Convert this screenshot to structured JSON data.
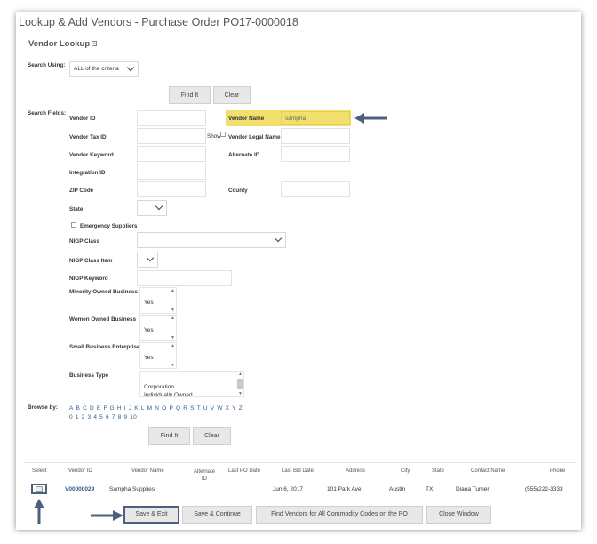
{
  "window": {
    "title": "Lookup & Add Vendors - Purchase Order PO17-0000018"
  },
  "section": {
    "title": "Vendor Lookup"
  },
  "search": {
    "search_using_label": "Search Using:",
    "search_using_value": "ALL of the criteria",
    "find_label": "Find It",
    "clear_label": "Clear",
    "fields_label": "Search Fields:"
  },
  "fields": {
    "vendor_id": "Vendor ID",
    "vendor_name": "Vendor Name",
    "vendor_name_value": "sampha",
    "vendor_tax_id": "Vendor Tax ID",
    "show": "Show",
    "vendor_legal_name": "Vendor Legal Name",
    "vendor_keyword": "Vendor Keyword",
    "alternate_id": "Alternate ID",
    "integration_id": "Integration ID",
    "zip_code": "ZIP Code",
    "county": "County",
    "state": "State",
    "emergency_suppliers": "Emergency Suppliers",
    "nigp_class": "NIGP Class",
    "nigp_class_item": "NIGP Class Item",
    "nigp_keyword": "NIGP Keyword",
    "minority_owned": "Minority Owned Business",
    "minority_owned_value": "Yes",
    "women_owned": "Women Owned Business",
    "women_owned_value": "Yes",
    "small_business": "Small Business Enterprise",
    "small_business_value": "Yes",
    "business_type": "Business Type",
    "business_type_options": [
      "Corporation",
      "Individually Owned"
    ]
  },
  "browse": {
    "label": "Browse by:",
    "letters": [
      "A",
      "B",
      "C",
      "D",
      "E",
      "F",
      "G",
      "H",
      "I",
      "J",
      "K",
      "L",
      "M",
      "N",
      "O",
      "P",
      "Q",
      "R",
      "S",
      "T",
      "U",
      "V",
      "W",
      "X",
      "Y",
      "Z"
    ],
    "digits": [
      "0",
      "1",
      "2",
      "3",
      "4",
      "5",
      "6",
      "7",
      "8",
      "9",
      "10"
    ]
  },
  "results": {
    "headers": {
      "select": "Select",
      "vendor_id": "Vendor ID",
      "vendor_name": "Vendor Name",
      "alternate_id": "Alternate ID",
      "last_po_date": "Last PO Date",
      "last_bid_date": "Last Bid Date",
      "address": "Address",
      "city": "City",
      "state": "State",
      "contact_name": "Contact Name",
      "phone": "Phone"
    },
    "rows": [
      {
        "vendor_id": "V00000029",
        "vendor_name": "Sampha Supplies",
        "alternate_id": "",
        "last_po_date": "",
        "last_bid_date": "Jun 6, 2017",
        "address": "101 Park Ave",
        "city": "Austin",
        "state": "TX",
        "contact_name": "Diana Turner",
        "phone": "(555)222-3333"
      }
    ]
  },
  "footer": {
    "save_exit": "Save & Exit",
    "save_continue": "Save & Continue",
    "find_all": "Find Vendors for All Commodity Codes on the PO",
    "close_window": "Close Window"
  },
  "colors": {
    "highlight": "#f2df6d",
    "link": "#2f5a8a",
    "arrow": "#4e6080"
  }
}
